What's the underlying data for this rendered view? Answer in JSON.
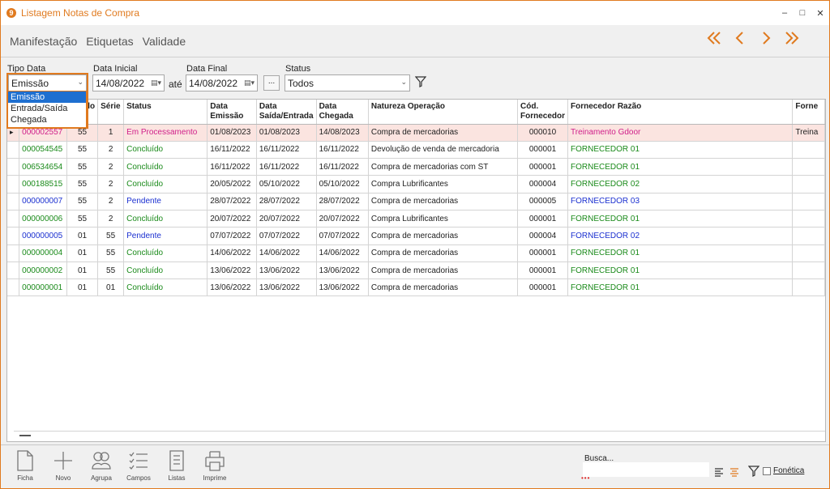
{
  "window": {
    "title": "Listagem Notas de Compra",
    "app_icon_glyph": "9",
    "accent_color": "#e07a1f",
    "controls": [
      "–",
      "□",
      "✕"
    ]
  },
  "menu": [
    "Manifestação",
    "Etiquetas",
    "Validade"
  ],
  "nav_icons": [
    "double-chevron-left-icon",
    "chevron-left-icon",
    "chevron-right-icon",
    "double-chevron-right-icon"
  ],
  "filters": {
    "tipo_data_label": "Tipo Data",
    "tipo_data_value": "Emissão",
    "data_inicial_label": "Data Inicial",
    "data_inicial_value": "14/08/2022",
    "ate": "até",
    "data_final_label": "Data Final",
    "data_final_value": "14/08/2022",
    "dots": "...",
    "status_label": "Status",
    "status_value": "Todos"
  },
  "tipo_data_options": [
    "Emissão",
    "Entrada/Saída",
    "Chegada"
  ],
  "grid": {
    "headers": [
      {
        "l1": "",
        "l2": ""
      },
      {
        "l1": "",
        "l2": ""
      },
      {
        "l1": "do",
        "l2": ""
      },
      {
        "l1": "Série",
        "l2": ""
      },
      {
        "l1": "Status",
        "l2": ""
      },
      {
        "l1": "Data",
        "l2": "Emissão"
      },
      {
        "l1": "Data",
        "l2": "Saída/Entrada"
      },
      {
        "l1": "Data",
        "l2": "Chegada"
      },
      {
        "l1": "Natureza Operação",
        "l2": ""
      },
      {
        "l1": "Cód.",
        "l2": "Fornecedor"
      },
      {
        "l1": "Fornecedor Razão",
        "l2": ""
      },
      {
        "l1": "Forne",
        "l2": ""
      }
    ],
    "status_colors": {
      "Em Processamento": "#d0208a",
      "Concluído": "#1a8a1a",
      "Pendente": "#1a2fd0"
    },
    "rows": [
      {
        "numero": "000002557",
        "modelo": "55",
        "serie": "1",
        "status": "Em Processamento",
        "emissao": "01/08/2023",
        "saida": "01/08/2023",
        "chegada": "14/08/2023",
        "natureza": "Compra de mercadorias",
        "cod": "000010",
        "razao": "Treinamento Gdoor",
        "extra": "Treina",
        "active": true
      },
      {
        "numero": "000054545",
        "modelo": "55",
        "serie": "2",
        "status": "Concluído",
        "emissao": "16/11/2022",
        "saida": "16/11/2022",
        "chegada": "16/11/2022",
        "natureza": "Devolução de venda de mercadoria",
        "cod": "000001",
        "razao": "FORNECEDOR 01",
        "extra": "",
        "active": false
      },
      {
        "numero": "006534654",
        "modelo": "55",
        "serie": "2",
        "status": "Concluído",
        "emissao": "16/11/2022",
        "saida": "16/11/2022",
        "chegada": "16/11/2022",
        "natureza": "Compra de mercadorias com ST",
        "cod": "000001",
        "razao": "FORNECEDOR 01",
        "extra": "",
        "active": false
      },
      {
        "numero": "000188515",
        "modelo": "55",
        "serie": "2",
        "status": "Concluído",
        "emissao": "20/05/2022",
        "saida": "05/10/2022",
        "chegada": "05/10/2022",
        "natureza": "Compra Lubrificantes",
        "cod": "000004",
        "razao": "FORNECEDOR 02",
        "extra": "",
        "active": false
      },
      {
        "numero": "000000007",
        "modelo": "55",
        "serie": "2",
        "status": "Pendente",
        "emissao": "28/07/2022",
        "saida": "28/07/2022",
        "chegada": "28/07/2022",
        "natureza": "Compra de mercadorias",
        "cod": "000005",
        "razao": "FORNECEDOR 03",
        "extra": "",
        "active": false
      },
      {
        "numero": "000000006",
        "modelo": "55",
        "serie": "2",
        "status": "Concluído",
        "emissao": "20/07/2022",
        "saida": "20/07/2022",
        "chegada": "20/07/2022",
        "natureza": "Compra Lubrificantes",
        "cod": "000001",
        "razao": "FORNECEDOR 01",
        "extra": "",
        "active": false
      },
      {
        "numero": "000000005",
        "modelo": "01",
        "serie": "55",
        "status": "Pendente",
        "emissao": "07/07/2022",
        "saida": "07/07/2022",
        "chegada": "07/07/2022",
        "natureza": "Compra de mercadorias",
        "cod": "000004",
        "razao": "FORNECEDOR 02",
        "extra": "",
        "active": false
      },
      {
        "numero": "000000004",
        "modelo": "01",
        "serie": "55",
        "status": "Concluído",
        "emissao": "14/06/2022",
        "saida": "14/06/2022",
        "chegada": "14/06/2022",
        "natureza": "Compra de mercadorias",
        "cod": "000001",
        "razao": "FORNECEDOR 01",
        "extra": "",
        "active": false
      },
      {
        "numero": "000000002",
        "modelo": "01",
        "serie": "55",
        "status": "Concluído",
        "emissao": "13/06/2022",
        "saida": "13/06/2022",
        "chegada": "13/06/2022",
        "natureza": "Compra de mercadorias",
        "cod": "000001",
        "razao": "FORNECEDOR 01",
        "extra": "",
        "active": false
      },
      {
        "numero": "000000001",
        "modelo": "01",
        "serie": "01",
        "status": "Concluído",
        "emissao": "13/06/2022",
        "saida": "13/06/2022",
        "chegada": "13/06/2022",
        "natureza": "Compra de mercadorias",
        "cod": "000001",
        "razao": "FORNECEDOR 01",
        "extra": "",
        "active": false
      }
    ]
  },
  "toolbar": [
    {
      "label": "Ficha",
      "icon": "document-icon"
    },
    {
      "label": "Novo",
      "icon": "plus-icon"
    },
    {
      "label": "Agrupa",
      "icon": "group-icon"
    },
    {
      "label": "Campos",
      "icon": "checklist-icon"
    },
    {
      "label": "Listas",
      "icon": "list-icon"
    },
    {
      "label": "Imprime",
      "icon": "printer-icon"
    }
  ],
  "search": {
    "label": "Busca...",
    "value": "",
    "foneticas_label": "Fonética",
    "foneticas_checked": false
  }
}
